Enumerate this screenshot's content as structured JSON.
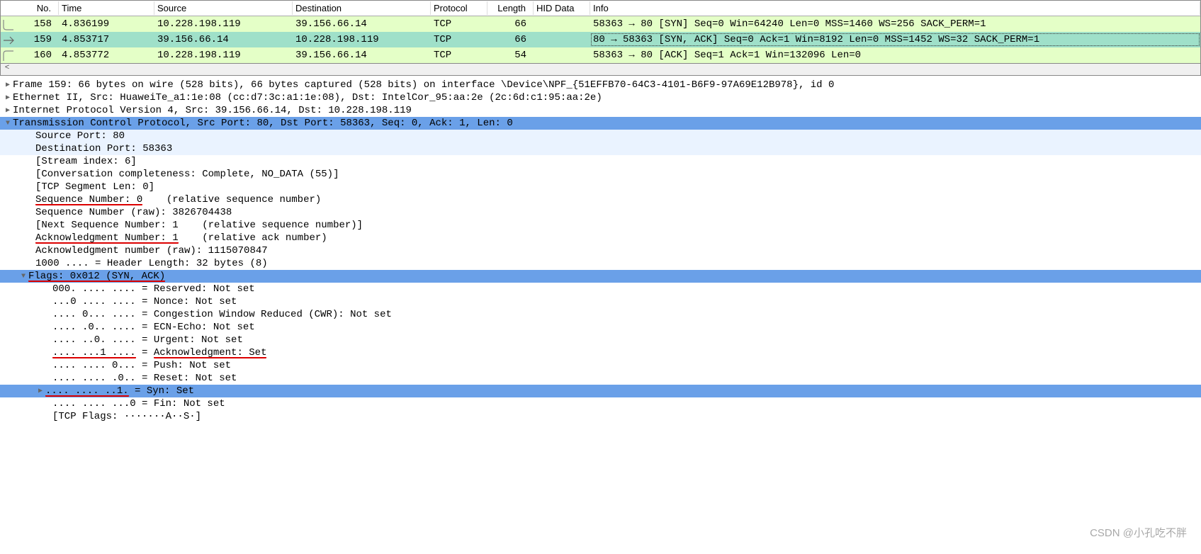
{
  "columns": {
    "no": "No.",
    "time": "Time",
    "src": "Source",
    "dst": "Destination",
    "proto": "Protocol",
    "len": "Length",
    "hid": "HID Data",
    "info": "Info"
  },
  "packets": [
    {
      "no": "158",
      "time": "4.836199",
      "src": "10.228.198.119",
      "dst": "39.156.66.14",
      "proto": "TCP",
      "len": "66",
      "hid": "",
      "info": "58363 → 80 [SYN] Seq=0 Win=64240 Len=0 MSS=1460 WS=256 SACK_PERM=1"
    },
    {
      "no": "159",
      "time": "4.853717",
      "src": "39.156.66.14",
      "dst": "10.228.198.119",
      "proto": "TCP",
      "len": "66",
      "hid": "",
      "info": "80 → 58363 [SYN, ACK] Seq=0 Ack=1 Win=8192 Len=0 MSS=1452 WS=32 SACK_PERM=1"
    },
    {
      "no": "160",
      "time": "4.853772",
      "src": "10.228.198.119",
      "dst": "39.156.66.14",
      "proto": "TCP",
      "len": "54",
      "hid": "",
      "info": "58363 → 80 [ACK] Seq=1 Ack=1 Win=132096 Len=0"
    }
  ],
  "detail": {
    "frame": "Frame 159: 66 bytes on wire (528 bits), 66 bytes captured (528 bits) on interface \\Device\\NPF_{51EFFB70-64C3-4101-B6F9-97A69E12B978}, id 0",
    "eth": "Ethernet II, Src: HuaweiTe_a1:1e:08 (cc:d7:3c:a1:1e:08), Dst: IntelCor_95:aa:2e (2c:6d:c1:95:aa:2e)",
    "ip": "Internet Protocol Version 4, Src: 39.156.66.14, Dst: 10.228.198.119",
    "tcp": "Transmission Control Protocol, Src Port: 80, Dst Port: 58363, Seq: 0, Ack: 1, Len: 0",
    "srcport": "Source Port: 80",
    "dstport": "Destination Port: 58363",
    "stream": "[Stream index: 6]",
    "conv": "[Conversation completeness: Complete, NO_DATA (55)]",
    "seglen": "[TCP Segment Len: 0]",
    "seq_a": "Sequence Number: 0",
    "seq_b": "    (relative sequence number)",
    "seqraw": "Sequence Number (raw): 3826704438",
    "nextseq": "[Next Sequence Number: 1    (relative sequence number)]",
    "ack_a": "Acknowledgment Number: 1",
    "ack_b": "    (relative ack number)",
    "ackraw": "Acknowledgment number (raw): 1115070847",
    "hlen": "1000 .... = Header Length: 32 bytes (8)",
    "flags": "Flags: 0x012 (SYN, ACK)",
    "f_res": "000. .... .... = Reserved: Not set",
    "f_non": "...0 .... .... = Nonce: Not set",
    "f_cwr": ".... 0... .... = Congestion Window Reduced (CWR): Not set",
    "f_ecn": ".... .0.. .... = ECN-Echo: Not set",
    "f_urg": ".... ..0. .... = Urgent: Not set",
    "f_ack_a": ".... ...1 ....",
    "f_ack_b": " = ",
    "f_ack_c": "Acknowledgment: Set",
    "f_psh": ".... .... 0... = Push: Not set",
    "f_rst": ".... .... .0.. = Reset: Not set",
    "f_syn_a": ".... .... ..1.",
    "f_syn_b": " = Syn: Set",
    "f_fin": ".... .... ...0 = Fin: Not set",
    "tcpflags": "[TCP Flags: ·······A··S·]"
  },
  "watermark": "CSDN @小孔吃不胖"
}
